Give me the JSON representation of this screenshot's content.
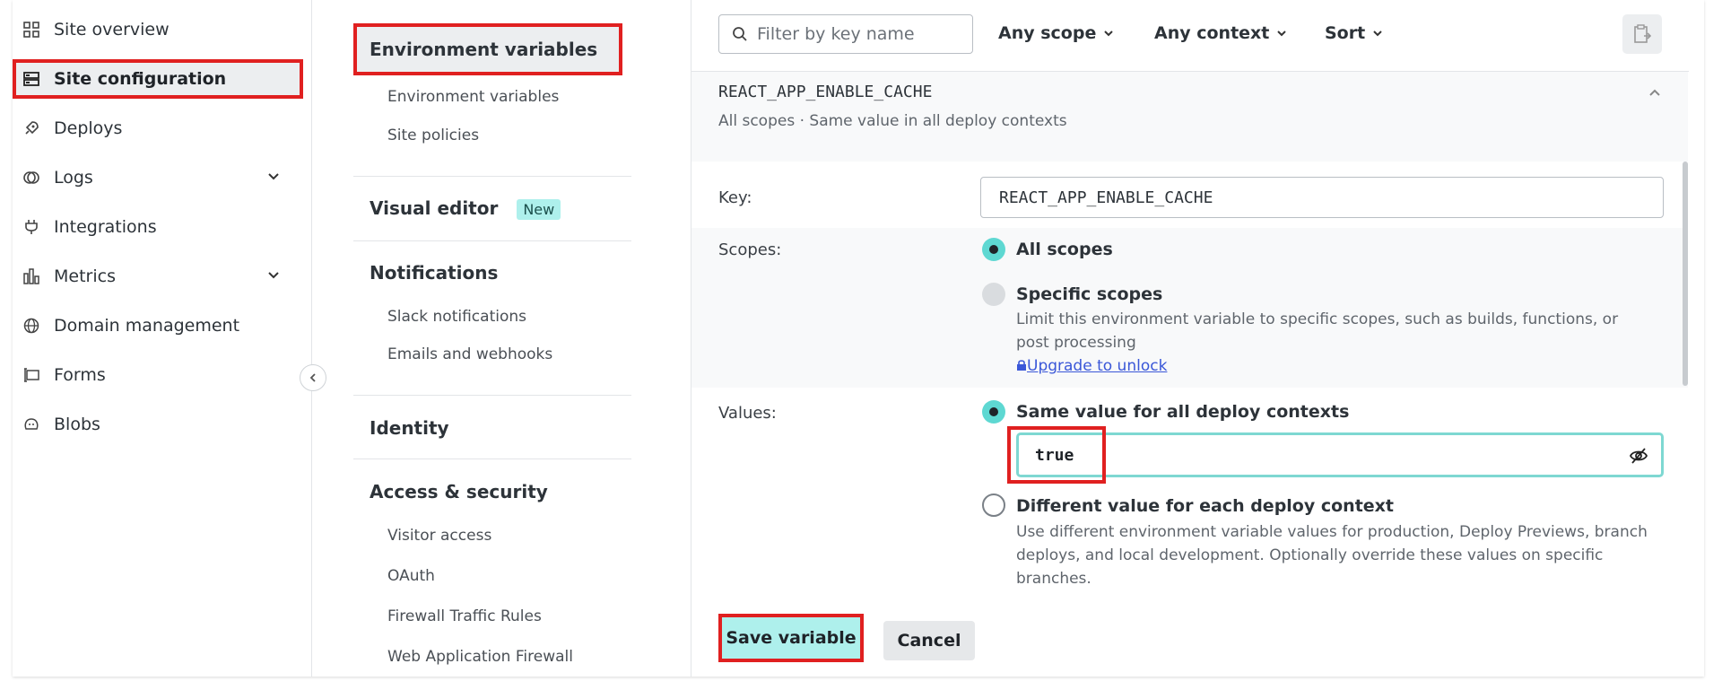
{
  "sidebar": {
    "items": [
      {
        "label": "Site overview",
        "icon": "grid-icon"
      },
      {
        "label": "Site configuration",
        "icon": "config-icon",
        "active": true
      },
      {
        "label": "Deploys",
        "icon": "rocket-icon"
      },
      {
        "label": "Logs",
        "icon": "logs-icon",
        "expandable": true
      },
      {
        "label": "Integrations",
        "icon": "plug-icon"
      },
      {
        "label": "Metrics",
        "icon": "bars-icon",
        "expandable": true
      },
      {
        "label": "Domain management",
        "icon": "globe-icon"
      },
      {
        "label": "Forms",
        "icon": "forms-icon"
      },
      {
        "label": "Blobs",
        "icon": "blob-icon"
      }
    ]
  },
  "midnav": {
    "env_title": "Environment variables",
    "env_items": [
      "Environment variables",
      "Site policies"
    ],
    "visual_title": "Visual editor",
    "visual_badge": "New",
    "notif_title": "Notifications",
    "notif_items": [
      "Slack notifications",
      "Emails and webhooks"
    ],
    "identity_title": "Identity",
    "access_title": "Access & security",
    "access_items": [
      "Visitor access",
      "OAuth",
      "Firewall Traffic Rules",
      "Web Application Firewall"
    ]
  },
  "toolbar": {
    "filter_placeholder": "Filter by key name",
    "scope_label": "Any scope",
    "context_label": "Any context",
    "sort_label": "Sort"
  },
  "variable": {
    "name": "REACT_APP_ENABLE_CACHE",
    "meta": "All scopes · Same value in all deploy contexts",
    "key_label": "Key:",
    "key_value": "REACT_APP_ENABLE_CACHE",
    "scopes_label": "Scopes:",
    "scope_all": "All scopes",
    "scope_specific": "Specific scopes",
    "scope_specific_desc": "Limit this environment variable to specific scopes, such as builds, functions, or post processing",
    "upgrade_link": "Upgrade to unlock",
    "values_label": "Values:",
    "value_same": "Same value for all deploy contexts",
    "value_current": "true",
    "value_different": "Different value for each deploy context",
    "value_different_desc": "Use different environment variable values for production, Deploy Previews, branch deploys, and local development. Optionally override these values on specific branches."
  },
  "actions": {
    "save": "Save variable",
    "cancel": "Cancel"
  },
  "colors": {
    "accent": "#5ed8d2",
    "highlight": "#e02020",
    "link": "#3a57d8"
  }
}
